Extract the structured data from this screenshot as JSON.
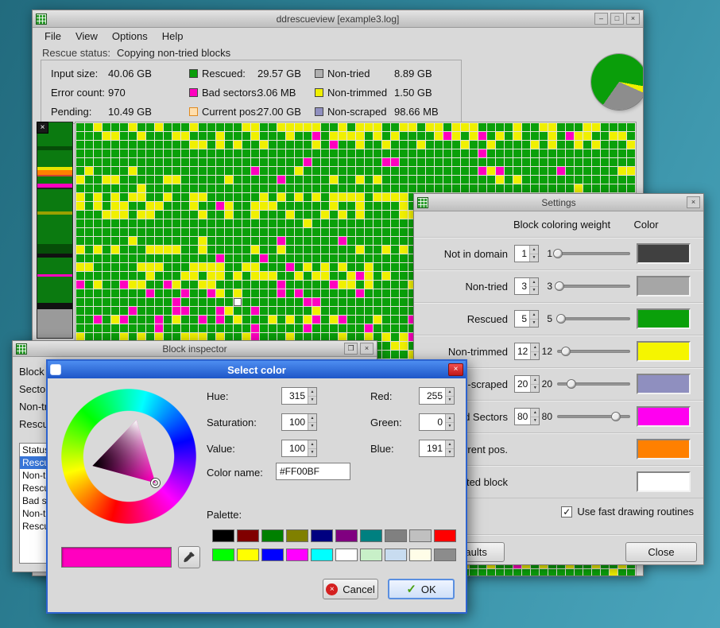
{
  "icons": {
    "minimize": "–",
    "maximize": "□",
    "close": "×",
    "restore": "❐",
    "check": "✓",
    "spin_up": "▲",
    "spin_down": "▼"
  },
  "main_window": {
    "title": "ddrescueview [example3.log]",
    "menu": [
      "File",
      "View",
      "Options",
      "Help"
    ],
    "status_label": "Rescue status:",
    "status_value": "Copying non-tried blocks",
    "stats": {
      "plain": [
        {
          "label": "Input size:",
          "value": "40.06 GB"
        },
        {
          "label": "Error count:",
          "value": "970"
        },
        {
          "label": "Pending:",
          "value": "10.49 GB"
        }
      ],
      "legend1": [
        {
          "label": "Rescued:",
          "value": "29.57 GB",
          "color": "#0a9e0a"
        },
        {
          "label": "Bad sectors:",
          "value": "3.06 MB",
          "color": "#ff00bf"
        },
        {
          "label": "Current pos:",
          "value": "27.00 GB",
          "color": "#ffdfae",
          "border": "#e08a20"
        }
      ],
      "legend2": [
        {
          "label": "Non-tried",
          "value": "8.89 GB",
          "color": "#b0b0b0"
        },
        {
          "label": "Non-trimmed",
          "value": "1.50 GB",
          "color": "#f0f000"
        },
        {
          "label": "Non-scraped",
          "value": "98.66 MB",
          "color": "#8f8fbf"
        }
      ]
    },
    "pie": {
      "slices": [
        [
          "#0a9e0a",
          0,
          100
        ],
        [
          "#f0f000",
          100,
          114
        ],
        [
          "#8d8d8d",
          114,
          215
        ],
        [
          "#0a9e0a",
          215,
          360
        ]
      ]
    },
    "overview": {
      "segments": [
        [
          "#0b7a10",
          10
        ],
        [
          "#064d08",
          1.5
        ],
        [
          "#0b7a10",
          7
        ],
        [
          "#e8e400",
          1.2
        ],
        [
          "#ff8000",
          2
        ],
        [
          "#cc4433",
          0.8
        ],
        [
          "#0b7a10",
          3
        ],
        [
          "#ff00bf",
          1.4
        ],
        [
          "#222222",
          0.8
        ],
        [
          "#0b7a10",
          9
        ],
        [
          "#9aa000",
          1.6
        ],
        [
          "#0b7a10",
          12
        ],
        [
          "#064d08",
          4
        ],
        [
          "#111111",
          1.6
        ],
        [
          "#0b7a10",
          7
        ],
        [
          "#ff00bf",
          0.9
        ],
        [
          "#0b7a10",
          11
        ],
        [
          "#111111",
          2.4
        ],
        [
          "#9a9a9a",
          12
        ]
      ]
    },
    "grid": {
      "cols": 64,
      "rows": 52,
      "cell": 10,
      "gap": 1,
      "seed": 20240613,
      "colors": {
        "good": "#0aa00a",
        "trim": "#f0f000",
        "bad": "#ff00bf"
      },
      "yellow_cycle": [
        0.42,
        0.34,
        0.26,
        0.02,
        0.01,
        0.03,
        0.3,
        0.02
      ],
      "bad_rows": [
        18,
        19,
        20,
        21,
        22,
        23,
        33,
        34,
        35
      ],
      "bad_heavy": 0.12,
      "bad_base": 0.02,
      "selected": {
        "row": 20,
        "col": 18,
        "color": "#ffffff"
      }
    }
  },
  "settings_window": {
    "title": "Settings",
    "header_weight": "Block coloring weight",
    "header_color": "Color",
    "weight_rows": [
      {
        "label": "Not in domain",
        "weight": 1,
        "color": "#404040"
      },
      {
        "label": "Non-tried",
        "weight": 3,
        "color": "#a6a6a6"
      },
      {
        "label": "Rescued",
        "weight": 5,
        "color": "#0aa00a"
      },
      {
        "label": "Non-trimmed",
        "weight": 12,
        "color": "#f5f500"
      },
      {
        "label": "Non-scraped",
        "weight": 20,
        "color": "#8f8fbf"
      },
      {
        "label": "Bad Sectors",
        "weight": 80,
        "color": "#ff00f0"
      }
    ],
    "color_rows": [
      {
        "label": "Current pos.",
        "color": "#ff8000"
      },
      {
        "label": "Selected block",
        "color": "#ffffff"
      }
    ],
    "fast_draw_label": "Use fast drawing routines",
    "fast_draw_checked": true,
    "defaults_label": "Defaults",
    "close_label": "Close"
  },
  "inspector_window": {
    "title": "Block inspector",
    "fields": [
      "Block info",
      "Sector offset:",
      "Non-tried:",
      "Rescued:"
    ],
    "list": [
      "Status",
      "Rescued",
      "Non-trimmed",
      "Rescued",
      "Bad sectors",
      "Non-tried",
      "Rescued"
    ],
    "selected_index": 1
  },
  "color_dialog": {
    "title": "Select color",
    "hsv": [
      {
        "label": "Hue:",
        "value": "315"
      },
      {
        "label": "Saturation:",
        "value": "100"
      },
      {
        "label": "Value:",
        "value": "100"
      }
    ],
    "rgb": [
      {
        "label": "Red:",
        "value": "255"
      },
      {
        "label": "Green:",
        "value": "0"
      },
      {
        "label": "Blue:",
        "value": "191"
      }
    ],
    "name_label": "Color name:",
    "name_value": "#FF00BF",
    "palette_label": "Palette:",
    "palette": [
      [
        "#000000",
        "#800000",
        "#008000",
        "#808000",
        "#000080",
        "#800080",
        "#008080",
        "#808080",
        "#c0c0c0",
        "#ff0000"
      ],
      [
        "#00ff00",
        "#ffff00",
        "#0000ff",
        "#ff00ff",
        "#00ffff",
        "#ffffff",
        "#c8f0c8",
        "#c8dcf0",
        "#fffde8",
        "#8c8c8c"
      ]
    ],
    "preview": "#ff00bf",
    "cancel_label": "Cancel",
    "ok_label": "OK"
  }
}
